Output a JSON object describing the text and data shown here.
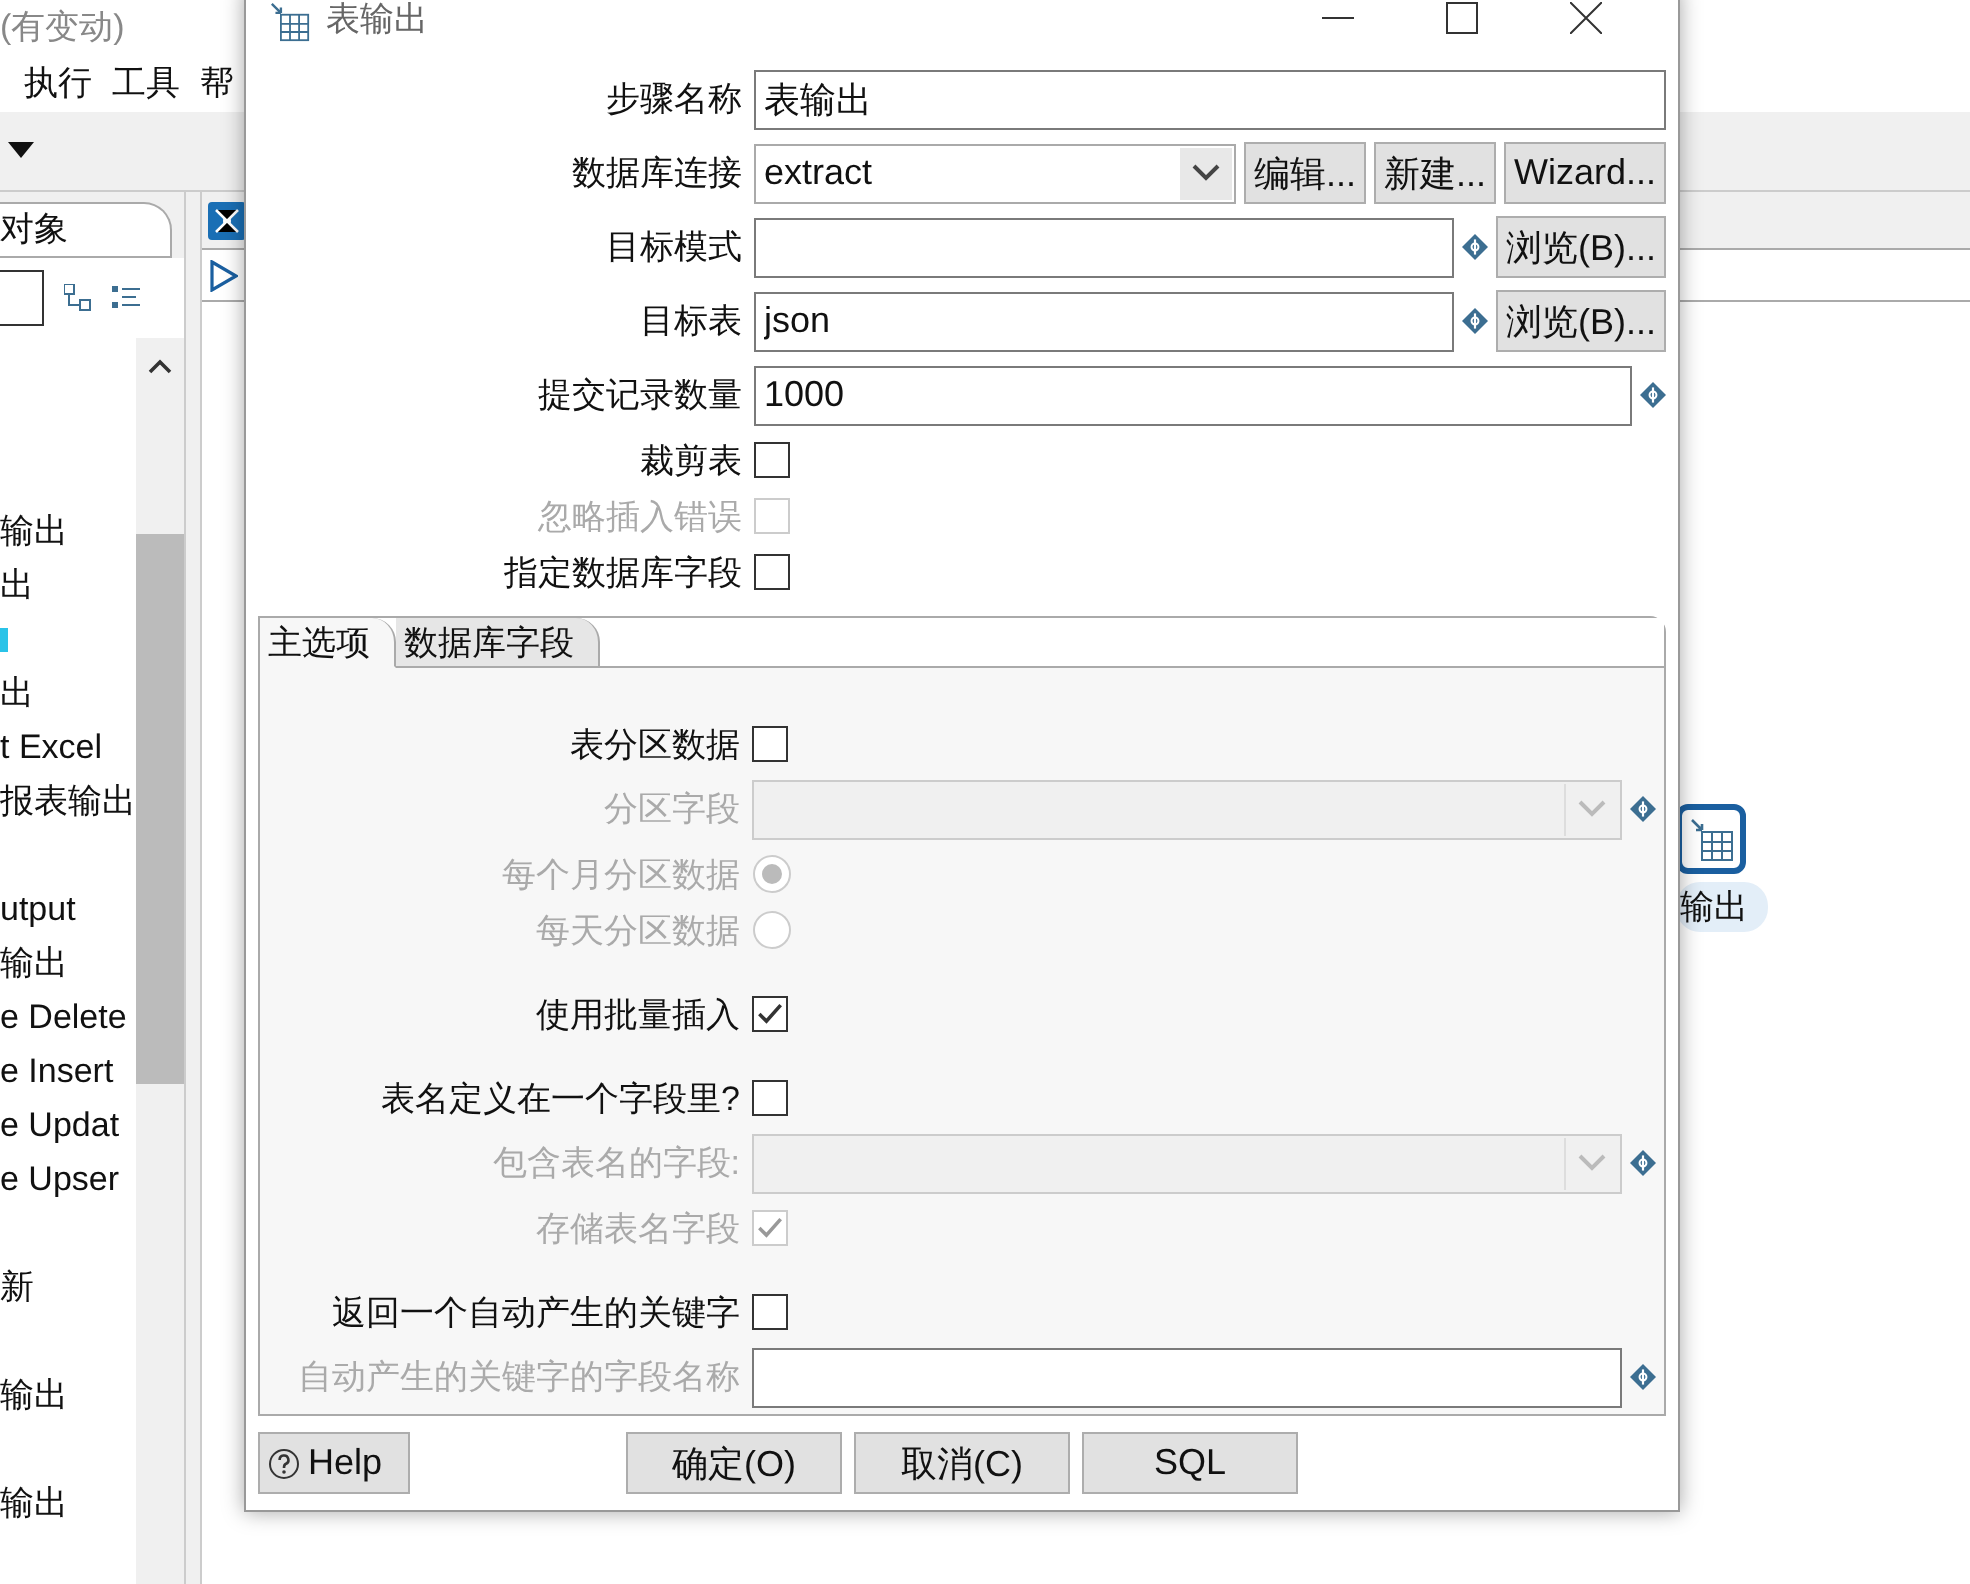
{
  "background": {
    "title": "(有变动)",
    "menu": [
      "执行",
      "工具",
      "帮"
    ],
    "panel_tab": "对象",
    "tree_groups": [
      [
        {
          "kind": "text",
          "label": "输出"
        },
        {
          "kind": "text",
          "label": "出"
        },
        {
          "kind": "icon"
        },
        {
          "kind": "text",
          "label": "出"
        },
        {
          "kind": "text",
          "label": "t Excel"
        },
        {
          "kind": "text",
          "label": "报表输出"
        }
      ],
      [
        {
          "kind": "text",
          "label": "utput"
        },
        {
          "kind": "text",
          "label": "输出"
        },
        {
          "kind": "text",
          "label": "e Delete"
        },
        {
          "kind": "text",
          "label": "e Insert"
        },
        {
          "kind": "text",
          "label": "e Updat"
        },
        {
          "kind": "text",
          "label": "e Upser"
        }
      ],
      [
        {
          "kind": "text",
          "label": "新"
        }
      ],
      [
        {
          "kind": "text",
          "label": "输出"
        }
      ],
      [
        {
          "kind": "text",
          "label": "输出"
        }
      ]
    ],
    "canvas_step": "输出"
  },
  "dialog": {
    "title": "表输出",
    "fields": [
      {
        "kind": "text",
        "label": "步骤名称",
        "value": "表输出",
        "variable": false
      },
      {
        "kind": "combo",
        "label": "数据库连接",
        "value": "extract",
        "disabled": false,
        "variable": false,
        "buttons": [
          "编辑...",
          "新建...",
          "Wizard..."
        ]
      },
      {
        "kind": "text",
        "label": "目标模式",
        "variable": true,
        "buttons": [
          "浏览(B)..."
        ]
      },
      {
        "kind": "text",
        "label": "目标表",
        "value": "json",
        "variable": true,
        "buttons": [
          "浏览(B)..."
        ]
      },
      {
        "kind": "text",
        "label": "提交记录数量",
        "value": "1000",
        "variable": true
      },
      {
        "kind": "checkbox",
        "label": "裁剪表",
        "checked": false,
        "disabled": false
      },
      {
        "kind": "checkbox",
        "label": "忽略插入错误",
        "checked": false,
        "disabled": true
      },
      {
        "kind": "checkbox",
        "label": "指定数据库字段",
        "checked": false,
        "disabled": false
      }
    ],
    "tabs": [
      {
        "label": "主选项",
        "selected": true
      },
      {
        "label": "数据库字段",
        "selected": false
      }
    ],
    "tab_groups": [
      [
        {
          "kind": "checkbox",
          "label": "表分区数据",
          "checked": false,
          "disabled": false
        },
        {
          "kind": "combo",
          "label": "分区字段",
          "disabled": true,
          "variable": true
        },
        {
          "kind": "radio",
          "label": "每个月分区数据",
          "selected": true,
          "disabled": true
        },
        {
          "kind": "radio",
          "label": "每天分区数据",
          "selected": false,
          "disabled": true
        }
      ],
      [
        {
          "kind": "checkbox",
          "label": "使用批量插入",
          "checked": true,
          "disabled": false
        }
      ],
      [
        {
          "kind": "checkbox",
          "label": "表名定义在一个字段里?",
          "checked": false,
          "disabled": false
        },
        {
          "kind": "combo",
          "label": "包含表名的字段:",
          "disabled": true,
          "variable": true
        },
        {
          "kind": "checkbox",
          "label": "存储表名字段",
          "checked": true,
          "disabled": true
        }
      ],
      [
        {
          "kind": "checkbox",
          "label": "返回一个自动产生的关键字",
          "checked": false,
          "disabled": false
        },
        {
          "kind": "text",
          "label": "自动产生的关键字的字段名称",
          "variable": true,
          "label_disabled": true
        }
      ]
    ],
    "buttons": [
      {
        "kind": "help",
        "label": "Help"
      },
      {
        "kind": "normal",
        "label": "确定(O)"
      },
      {
        "kind": "normal",
        "label": "取消(C)"
      },
      {
        "kind": "normal",
        "label": "SQL"
      }
    ]
  }
}
